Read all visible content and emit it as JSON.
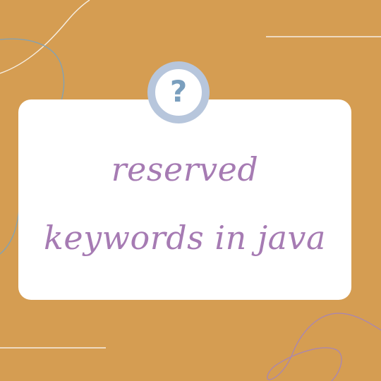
{
  "theme": {
    "background": "#d59d52",
    "card": "#ffffff",
    "badge_ring": "#b7c6dc",
    "question_mark": "#7a9fbe",
    "title_text": "#a67bb3",
    "line_light": "#f6efe4",
    "curve_blue": "#7fa2b8",
    "curve_purple": "#a785b5"
  },
  "badge": {
    "icon": "question-mark-icon",
    "glyph": "?"
  },
  "title": {
    "line1": "reserved",
    "line2": "keywords in java"
  }
}
